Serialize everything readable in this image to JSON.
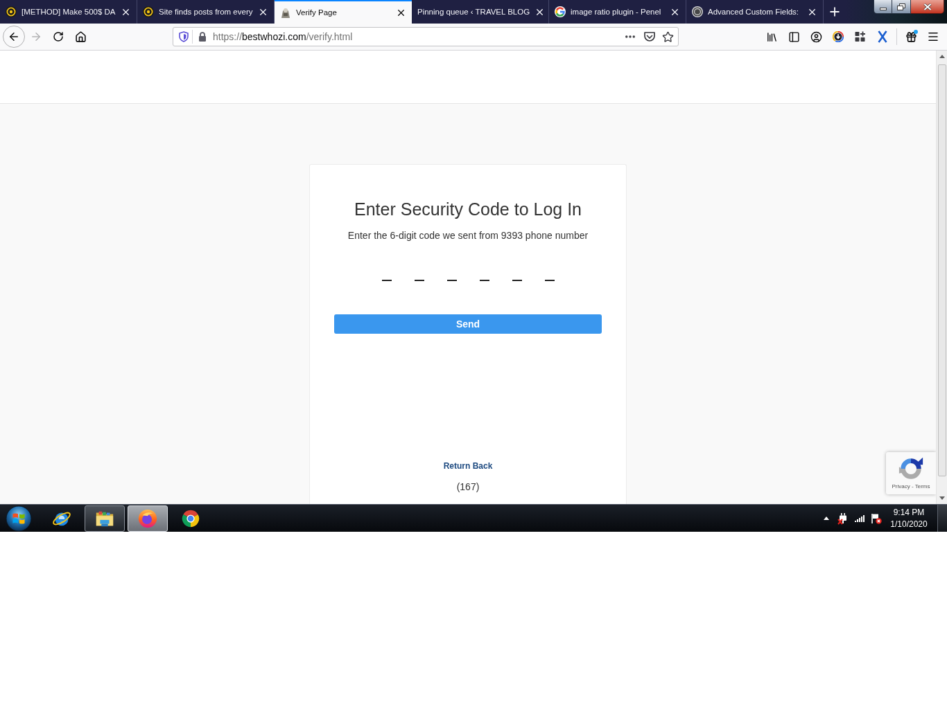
{
  "browser": {
    "tabs": [
      {
        "title": "[METHOD] Make 500$ DA",
        "selected": false
      },
      {
        "title": "Site finds posts from every",
        "selected": false
      },
      {
        "title": "Verify Page",
        "selected": true
      },
      {
        "title": "Pinning queue ‹ TRAVEL BLOG",
        "selected": false
      },
      {
        "title": "image ratio plugin - Penel",
        "selected": false
      },
      {
        "title": "Advanced Custom Fields:",
        "selected": false
      }
    ],
    "toolbar": {
      "back_disabled": false,
      "forward_disabled": true,
      "gift_notification": true
    },
    "address_bar": {
      "scheme": "https://",
      "host": "bestwhozi.com",
      "path": "/verify.html"
    }
  },
  "page": {
    "title": "Enter Security Code to Log In",
    "subtitle": "Enter the 6-digit code we sent from 9393 phone number",
    "code_fields": [
      {
        "filled": false
      },
      {
        "filled": false
      },
      {
        "filled": false
      },
      {
        "filled": false
      },
      {
        "filled": false
      },
      {
        "filled": false
      }
    ],
    "send_button": "Send",
    "return_link": "Return Back",
    "counter": "(167)",
    "recaptcha_links": "Privacy - Terms"
  },
  "taskbar": {
    "apps": [
      {
        "running": false,
        "selected": false
      },
      {
        "running": true,
        "selected": false
      },
      {
        "running": true,
        "selected": true
      },
      {
        "running": false,
        "selected": false
      }
    ],
    "clock": {
      "time": "9:14 PM",
      "date": "1/10/2020"
    }
  }
}
